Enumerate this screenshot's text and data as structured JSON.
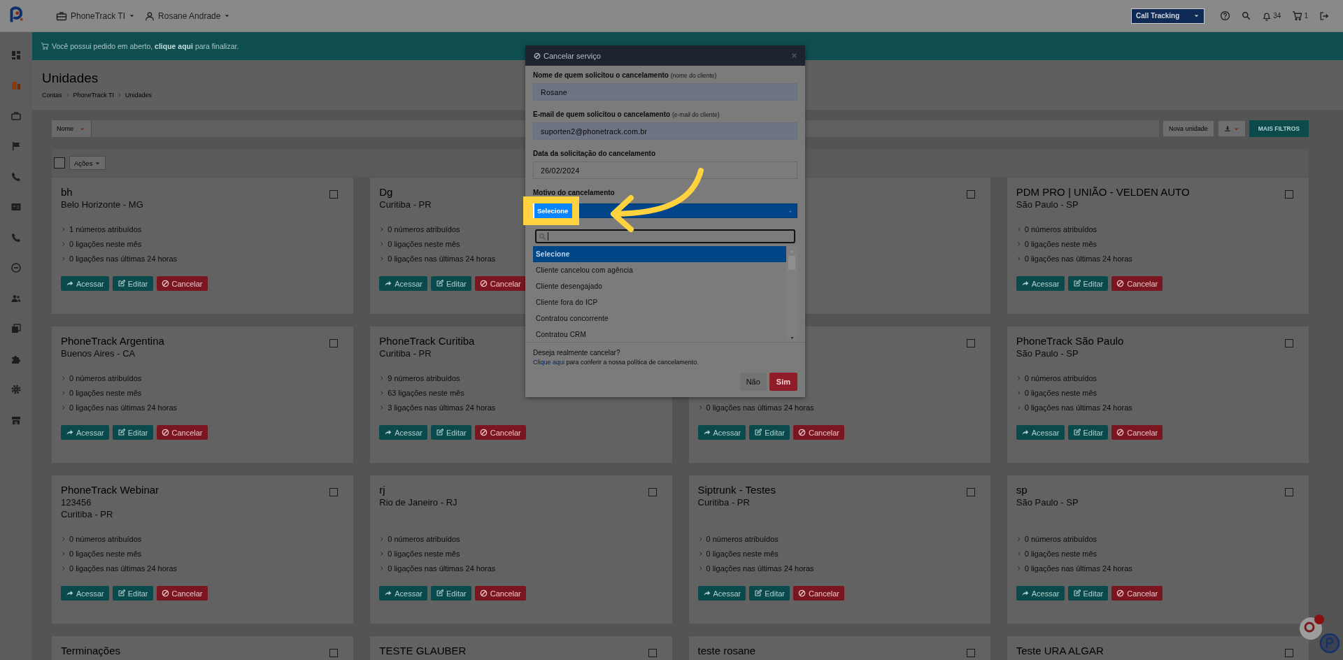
{
  "topbar": {
    "account": "PhoneTrack TI",
    "user": "Rosane Andrade",
    "product": "Call Tracking",
    "notifications": "34",
    "cart": "1"
  },
  "sidebar": {
    "items": [
      {
        "kind": "dashboard",
        "selected": false
      },
      {
        "kind": "building",
        "selected": true
      },
      {
        "kind": "briefcase",
        "selected": false
      },
      {
        "kind": "flag",
        "selected": false
      },
      {
        "kind": "phone",
        "selected": false
      },
      {
        "kind": "card",
        "selected": false
      },
      {
        "kind": "phone",
        "selected": false
      },
      {
        "kind": "minus",
        "selected": false
      },
      {
        "kind": "users",
        "selected": false
      },
      {
        "kind": "copy",
        "selected": false
      },
      {
        "kind": "puzzle",
        "selected": false
      },
      {
        "kind": "gear",
        "selected": false
      },
      {
        "kind": "store",
        "selected": false
      }
    ]
  },
  "banner": {
    "before": "Você possui pedido em aberto,",
    "link": "clique aqui",
    "after": "para finalizar."
  },
  "page": {
    "title": "Unidades",
    "breadcrumb": [
      "Contas",
      "PhoneTrack TI",
      "Unidades"
    ]
  },
  "filters": {
    "field": "Nome",
    "new_button": "Nova unidade",
    "more_button": "MAIS FILTROS"
  },
  "bulk": {
    "checked": false,
    "actions": "Ações"
  },
  "units": [
    {
      "title": "bh",
      "location": "Belo Horizonte - MG",
      "checked": false,
      "stats": [
        "1 números atribuídos",
        "0 ligações neste mês",
        "0 ligações nas últimas 24 horas"
      ],
      "buttons": [
        {
          "kind": "access",
          "label": "Acessar"
        },
        {
          "kind": "edit",
          "label": "Editar"
        },
        {
          "kind": "cancel",
          "label": "Cancelar"
        }
      ]
    },
    {
      "title": "Dg",
      "location": "Curitiba - PR",
      "stats": [
        "0 números atribuídos",
        "0 ligações neste mês",
        "0 ligações nas últimas 24 horas"
      ],
      "buttons": [
        {
          "kind": "access",
          "label": "Acessar"
        },
        {
          "kind": "edit",
          "label": "Editar"
        },
        {
          "kind": "cancel",
          "label": "Cancelar"
        }
      ]
    },
    {
      "checked": false
    },
    {
      "title": "PDM PRO | UNIÃO - VELDEN AUTO",
      "location": "São Paulo - SP",
      "checked": false,
      "stats": [
        "0 números atribuídos",
        "0 ligações neste mês",
        "0 ligações nas últimas 24 horas"
      ],
      "buttons": [
        {
          "kind": "access",
          "label": "Acessar"
        },
        {
          "kind": "edit",
          "label": "Editar"
        },
        {
          "kind": "cancel",
          "label": "Cancelar"
        }
      ]
    },
    {
      "title": "PhoneTrack Argentina",
      "location": "Buenos Aires - CA",
      "checked": false,
      "stats": [
        "0 números atribuídos",
        "0 ligações neste mês",
        "0 ligações nas últimas 24 horas"
      ],
      "buttons": [
        {
          "kind": "access",
          "label": "Acessar"
        },
        {
          "kind": "edit",
          "label": "Editar"
        },
        {
          "kind": "cancel",
          "label": "Cancelar"
        }
      ]
    },
    {
      "title": "PhoneTrack Curitiba",
      "location": "Curitiba - PR",
      "stats": [
        "9 números atribuídos",
        "63 ligações neste mês",
        "3 ligações nas últimas 24 horas"
      ],
      "buttons": [
        {
          "kind": "access",
          "label": "Acessar"
        },
        {
          "kind": "edit",
          "label": "Editar"
        },
        {
          "kind": "cancel",
          "label": "Cancelar"
        }
      ]
    },
    {
      "checked": false,
      "stats": [
        "0 ligações nas últimas 24 horas"
      ],
      "buttons": [
        {
          "kind": "access",
          "label": "Acessar"
        },
        {
          "kind": "edit",
          "label": "Editar"
        },
        {
          "kind": "cancel",
          "label": "Cancelar"
        }
      ]
    },
    {
      "title": "PhoneTrack São Paulo",
      "location": "São Paulo - SP",
      "checked": false,
      "stats": [
        "0 números atribuídos",
        "0 ligações neste mês",
        "0 ligações nas últimas 24 horas"
      ],
      "buttons": [
        {
          "kind": "access",
          "label": "Acessar"
        },
        {
          "kind": "edit",
          "label": "Editar"
        },
        {
          "kind": "cancel",
          "label": "Cancelar"
        }
      ]
    },
    {
      "title": "PhoneTrack Webinar",
      "subtitle": "123456",
      "location": "Curitiba - PR",
      "checked": false,
      "stats": [
        "0 números atribuídos",
        "0 ligações neste mês",
        "0 ligações nas últimas 24 horas"
      ],
      "buttons": [
        {
          "kind": "access",
          "label": "Acessar"
        },
        {
          "kind": "edit",
          "label": "Editar"
        },
        {
          "kind": "cancel",
          "label": "Cancelar"
        }
      ]
    },
    {
      "title": "rj",
      "location": "Rio de Janeiro - RJ",
      "checked": false,
      "stats": [
        "0 números atribuídos",
        "0 ligações neste mês",
        "0 ligações nas últimas 24 horas"
      ],
      "buttons": [
        {
          "kind": "access",
          "label": "Acessar"
        },
        {
          "kind": "edit",
          "label": "Editar"
        },
        {
          "kind": "cancel",
          "label": "Cancelar"
        }
      ]
    },
    {
      "title": "Siptrunk - Testes",
      "location": "Curitiba - PR",
      "checked": false,
      "stats": [
        "0 números atribuídos",
        "0 ligações neste mês",
        "0 ligações nas últimas 24 horas"
      ],
      "buttons": [
        {
          "kind": "access",
          "label": "Acessar"
        },
        {
          "kind": "edit",
          "label": "Editar"
        },
        {
          "kind": "cancel",
          "label": "Cancelar"
        }
      ]
    },
    {
      "title": "sp",
      "location": "São Paulo - SP",
      "checked": false,
      "stats": [
        "0 números atribuídos",
        "0 ligações neste mês",
        "0 ligações nas últimas 24 horas"
      ],
      "buttons": [
        {
          "kind": "access",
          "label": "Acessar"
        },
        {
          "kind": "edit",
          "label": "Editar"
        },
        {
          "kind": "cancel",
          "label": "Cancelar"
        }
      ]
    },
    {
      "title": "Terminações",
      "checked": false
    },
    {
      "title": "TESTE GLAUBER",
      "checked": false
    },
    {
      "title": "teste rosane",
      "checked": false
    },
    {
      "title": "Teste URA ALGAR",
      "checked": false
    }
  ],
  "modal": {
    "title": "Cancelar serviço",
    "fields": [
      {
        "label": "Nome de quem solicitou o cancelamento",
        "hint": "(nome do cliente)",
        "value": "Rosane",
        "disabled": true
      },
      {
        "label": "E-mail de quem solicitou o cancelamento",
        "hint": "(e-mail do cliente)",
        "value": "suporten2@phonetrack.com.br",
        "disabled": true
      },
      {
        "label": "Data da solicitação do cancelamento",
        "value": "26/02/2024",
        "disabled": false
      }
    ],
    "reason": {
      "label": "Motivo do cancelamento",
      "value": "Selecione",
      "expanded": true,
      "options": [
        {
          "label": "Selecione",
          "selected": true
        },
        {
          "label": "Cliente cancelou com agência",
          "selected": false
        },
        {
          "label": "Cliente desengajado",
          "selected": false
        },
        {
          "label": "Cliente fora do ICP",
          "selected": false
        },
        {
          "label": "Contratou concorrente",
          "selected": false
        },
        {
          "label": "Contratou CRM",
          "selected": false
        }
      ]
    },
    "question": "Deseja realmente cancelar?",
    "policy_link": "Clique aqui",
    "policy_text": "para conferir a nossa política de cancelamento.",
    "no": "Não",
    "yes": "Sim"
  }
}
